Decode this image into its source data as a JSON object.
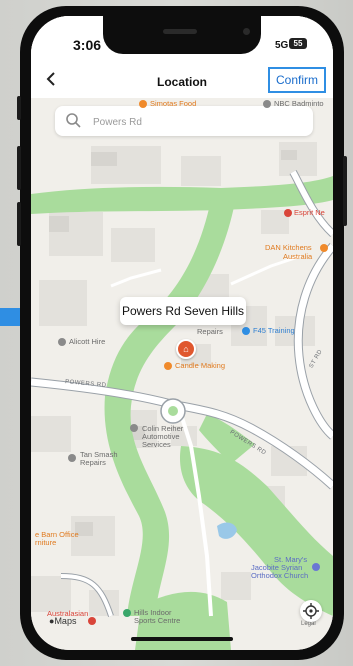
{
  "status": {
    "time": "3:06",
    "network": "5G",
    "battery": "55"
  },
  "nav": {
    "back_icon": "chevron-left-icon",
    "title": "Location",
    "confirm_label": "Confirm"
  },
  "search": {
    "placeholder": "Powers Rd",
    "icon": "search-icon"
  },
  "callout": {
    "text": "Powers Rd Seven Hills"
  },
  "pois": {
    "simotas": "Simotas Food",
    "nbc": "NBC Badminto",
    "esprit": "Esprit Ne",
    "dan1": "DAN Kitchens",
    "dan2": "Australia",
    "repairs": "Repairs",
    "f45": "F45 Training",
    "alicott": "Alicott Hire",
    "candle": "Candle Making",
    "colin1": "Colin Reiher",
    "colin2": "Automotive",
    "colin3": "Services",
    "tan1": "Tan Smash",
    "tan2": "Repairs",
    "barn1": "e Barn Office",
    "barn2": "rniture",
    "stmary1": "St. Mary's",
    "stmary2": "Jacobite Syrian",
    "stmary3": "Orthodox Church",
    "hills1": "Hills Indoor",
    "hills2": "Sports Centre",
    "austra": "Australasian",
    "legal": "Legal"
  },
  "roads": {
    "powers_left": "POWERS RD",
    "powers_right": "POWERS RD",
    "east": "ST RD"
  },
  "map": {
    "attribution": "Maps",
    "locate_icon": "location-target-icon",
    "pin_icon": "home-pin-icon"
  },
  "colors": {
    "accent": "#2f8ee3",
    "park": "#a9dc9c",
    "road": "#ffffff",
    "pin": "#e0582f"
  }
}
